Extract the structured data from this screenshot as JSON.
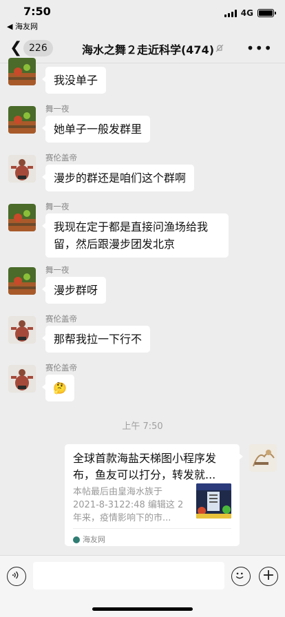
{
  "status_bar": {
    "time": "7:50",
    "back_app": "◀ 海友网",
    "network": "4G"
  },
  "header": {
    "back_count": "226",
    "title": "海水之舞２走近科学(474)",
    "mute_icon": "bell-muted-icon",
    "more_icon": "more-dots-icon"
  },
  "messages": [
    {
      "sender": "",
      "text": "我没单子",
      "avatar": "fish-tank-avatar"
    },
    {
      "sender": "舞一夜",
      "text": "她单子一般发群里",
      "avatar": "fish-tank-avatar"
    },
    {
      "sender": "赛伦盖帝",
      "text": "漫步的群还是咱们这个群啊",
      "avatar": "strongman-avatar"
    },
    {
      "sender": "舞一夜",
      "text_line1": "我现在定于都是直接问渔场给我",
      "text_line2": "留，然后跟漫步团发北京",
      "avatar": "fish-tank-avatar"
    },
    {
      "sender": "舞一夜",
      "text": "漫步群呀",
      "avatar": "fish-tank-avatar"
    },
    {
      "sender": "赛伦盖帝",
      "text": "那帮我拉一下行不",
      "avatar": "strongman-avatar"
    },
    {
      "sender": "赛伦盖帝",
      "text": "🤔",
      "avatar": "strongman-avatar"
    }
  ],
  "timestamp": "上午 7:50",
  "link_card": {
    "title_line1": "全球首款海盐天梯图小程序发",
    "title_line2": "布，鱼友可以打分，转发就...",
    "desc_line1": "本帖最后由皇海水族于",
    "desc_line2": "2021-8-3122:48 编辑这 2",
    "desc_line3": "年来，疫情影响下的市...",
    "source": "海友网"
  },
  "input_bar": {
    "voice_icon": "voice-icon",
    "emoji_icon": "emoji-icon",
    "plus_icon": "plus-icon",
    "plus_glyph": "+"
  }
}
